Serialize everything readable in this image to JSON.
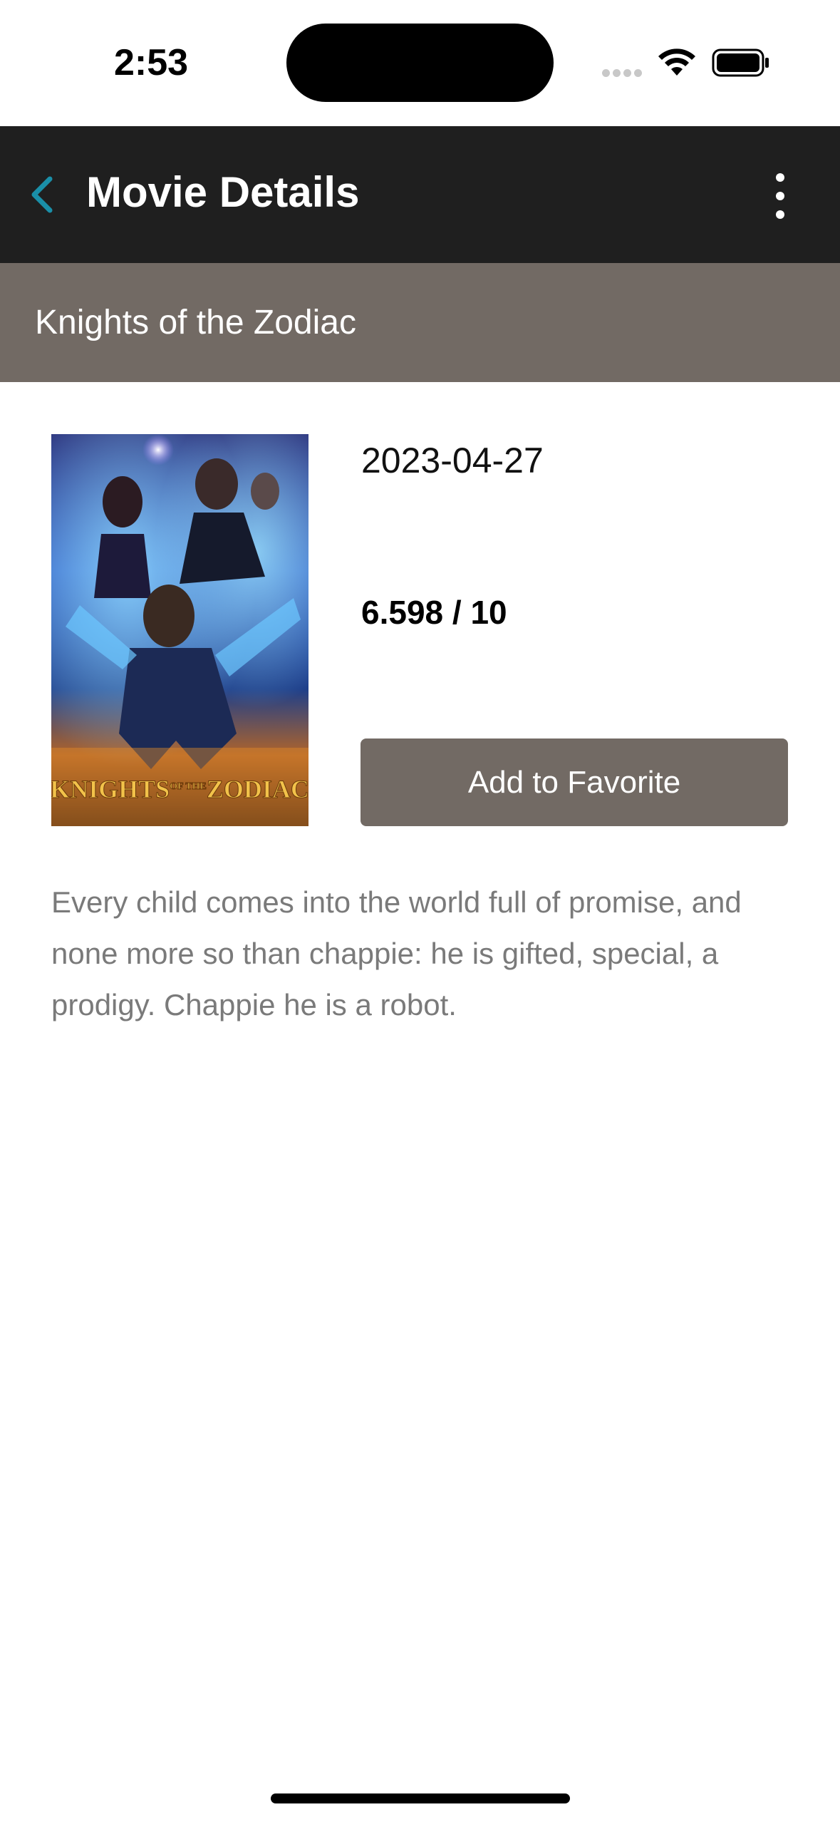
{
  "status_bar": {
    "time": "2:53"
  },
  "app_bar": {
    "title": "Movie Details",
    "back_icon": "chevron-left-icon",
    "menu_icon": "more-vertical-icon",
    "back_color": "#1a8fa8",
    "background": "#1f1f1f"
  },
  "movie": {
    "title": "Knights of the Zodiac",
    "release_date": "2023-04-27",
    "rating": "6.598 / 10",
    "favorite_label": "Add to Favorite",
    "overview": "Every child comes into the world full of promise, and none more so than chappie: he is gifted, special, a prodigy. Chappie he is a robot.",
    "poster_text": "KNIGHTS",
    "poster_text_of": "OF THE",
    "poster_text_zodiac": "ZODIAC"
  },
  "colors": {
    "accent_band": "#726a64",
    "button": "#726a64"
  }
}
